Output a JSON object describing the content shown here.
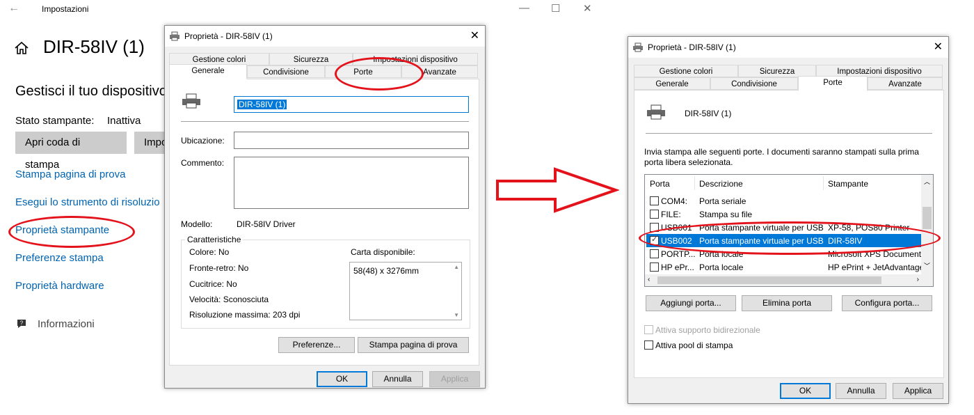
{
  "settings": {
    "title": "Impostazioni",
    "back_icon": "←",
    "minimize_icon": "—",
    "maximize_icon": "☐",
    "close_icon": "✕",
    "device_name": "DIR-58IV (1)",
    "section_title": "Gestisci il tuo dispositivo",
    "status_label": "Stato stampante:",
    "status_value": "Inattiva",
    "btn_queue": "Apri coda di stampa",
    "btn_second": "Impo",
    "links": [
      "Stampa pagina di prova",
      "Esegui lo strumento di risoluzio",
      "Proprietà stampante",
      "Preferenze stampa",
      "Proprietà hardware"
    ],
    "info": "Informazioni"
  },
  "dialog1": {
    "title": "Proprietà - DIR-58IV (1)",
    "tabs_row1": [
      "Gestione colori",
      "Sicurezza",
      "Impostazioni dispositivo"
    ],
    "tabs_row2": [
      "Generale",
      "Condivisione",
      "Porte",
      "Avanzate"
    ],
    "name_value": "DIR-58IV (1)",
    "location_label": "Ubicazione:",
    "comment_label": "Commento:",
    "model_label": "Modello:",
    "model_value": "DIR-58IV Driver",
    "features_label": "Caratteristiche",
    "feat": [
      "Colore: No",
      "Fronte-retro: No",
      "Cucitrice: No",
      "Velocità: Sconosciuta",
      "Risoluzione massima: 203 dpi"
    ],
    "paper_label": "Carta disponibile:",
    "paper_item": "58(48) x 3276mm",
    "btn_prefs": "Preferenze...",
    "btn_test": "Stampa pagina di prova",
    "btn_ok": "OK",
    "btn_cancel": "Annulla",
    "btn_apply": "Applica"
  },
  "dialog2": {
    "title": "Proprietà - DIR-58IV (1)",
    "tabs_row1": [
      "Gestione colori",
      "Sicurezza",
      "Impostazioni dispositivo"
    ],
    "tabs_row2": [
      "Generale",
      "Condivisione",
      "Porte",
      "Avanzate"
    ],
    "printer_name": "DIR-58IV (1)",
    "description": "Invia stampa alle seguenti porte. I documenti saranno stampati sulla prima porta libera selezionata.",
    "columns": [
      "Porta",
      "Descrizione",
      "Stampante"
    ],
    "rows": [
      {
        "port": "COM4:",
        "desc": "Porta seriale",
        "printer": "",
        "checked": false,
        "selected": false
      },
      {
        "port": "FILE:",
        "desc": "Stampa su file",
        "printer": "",
        "checked": false,
        "selected": false
      },
      {
        "port": "USB001",
        "desc": "Porta stampante virtuale per USB",
        "printer": "XP-58, POS80 Printer",
        "checked": false,
        "selected": false
      },
      {
        "port": "USB002",
        "desc": "Porta stampante virtuale per USB",
        "printer": "DIR-58IV",
        "checked": true,
        "selected": true
      },
      {
        "port": "PORTP...",
        "desc": "Porta locale",
        "printer": "Microsoft XPS Document",
        "checked": false,
        "selected": false
      },
      {
        "port": "HP ePr...",
        "desc": "Porta locale",
        "printer": "HP ePrint + JetAdvantage",
        "checked": false,
        "selected": false
      }
    ],
    "btn_add": "Aggiungi porta...",
    "btn_delete": "Elimina porta",
    "btn_config": "Configura porta...",
    "bidir": "Attiva supporto bidirezionale",
    "pool": "Attiva pool di stampa",
    "btn_ok": "OK",
    "btn_cancel": "Annulla",
    "btn_apply": "Applica"
  },
  "colors": {
    "annotation_red": "#e3121b",
    "link_blue": "#0063b1",
    "selection_blue": "#0078d7"
  }
}
